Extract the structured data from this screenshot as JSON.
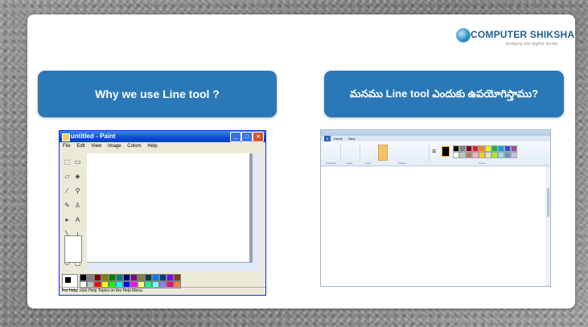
{
  "logo": {
    "brand_a": "C",
    "brand_b": "OMPUTER SHIKSHA",
    "tagline": "bridging the digital divide"
  },
  "question_en": "Why we use Line tool ?",
  "question_te": "మనము Line tool  ఎందుకు ఉపయోగిస్తాము?",
  "xp_paint": {
    "title": "untitled - Paint",
    "menu": [
      "File",
      "Edit",
      "View",
      "Image",
      "Colors",
      "Help"
    ],
    "status": "For Help, click Help Topics on the Help Menu.",
    "tool_icons": [
      "free-select",
      "rect-select",
      "eraser",
      "fill",
      "picker",
      "magnifier",
      "pencil",
      "brush",
      "airbrush",
      "text",
      "line",
      "curve",
      "rectangle",
      "polygon",
      "ellipse",
      "rounded-rect"
    ],
    "palette": [
      "#000000",
      "#808080",
      "#800000",
      "#808000",
      "#008000",
      "#008080",
      "#000080",
      "#800080",
      "#808040",
      "#004040",
      "#0080ff",
      "#004080",
      "#8000ff",
      "#804000",
      "#ffffff",
      "#c0c0c0",
      "#ff0000",
      "#ffff00",
      "#00ff00",
      "#00ffff",
      "#0000ff",
      "#ff00ff",
      "#ffff80",
      "#00ff80",
      "#80ffff",
      "#8080ff",
      "#ff0080",
      "#ff8040"
    ]
  },
  "win7_paint": {
    "tabs": [
      "Home",
      "View"
    ],
    "groups": [
      "Clipboard",
      "Image",
      "Tools",
      "Shapes",
      "Colors"
    ],
    "colors": [
      "#000000",
      "#7f7f7f",
      "#880015",
      "#ed1c24",
      "#ff7f27",
      "#fff200",
      "#22b14c",
      "#00a2e8",
      "#3f48cc",
      "#a349a4",
      "#ffffff",
      "#c3c3c3",
      "#b97a57",
      "#ffaec9",
      "#ffc90e",
      "#efe4b0",
      "#b5e61d",
      "#99d9ea",
      "#7092be",
      "#c8bfe7"
    ]
  }
}
